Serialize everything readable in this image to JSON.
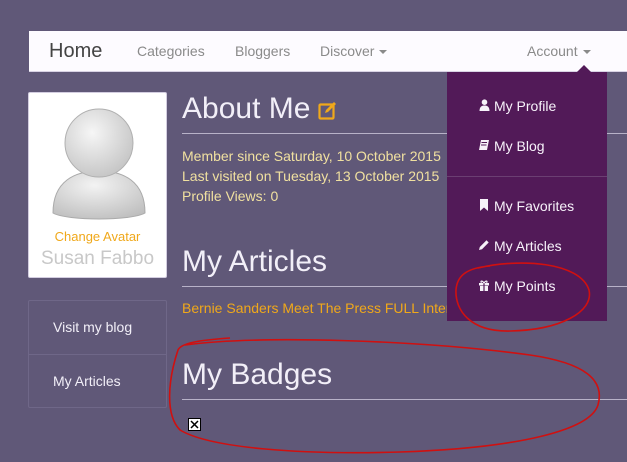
{
  "navbar": {
    "brand": "Home",
    "links": [
      "Categories",
      "Bloggers",
      "Discover"
    ],
    "account": "Account"
  },
  "profile": {
    "change_avatar": "Change Avatar",
    "username": "Susan Fabbo"
  },
  "sidebar": {
    "items": [
      {
        "label": "Visit my blog"
      },
      {
        "label": "My Articles"
      }
    ]
  },
  "about": {
    "title": "About Me",
    "member_since": "Member since Saturday, 10 October 2015",
    "last_visited": "Last visited on Tuesday, 13 October 2015",
    "profile_views": "Profile Views: 0"
  },
  "articles": {
    "title": "My Articles",
    "link": "Bernie Sanders Meet The Press FULL Interv"
  },
  "badges": {
    "title": "My Badges"
  },
  "dropdown": {
    "items": [
      {
        "label": "My Profile",
        "icon": "user-icon"
      },
      {
        "label": "My Blog",
        "icon": "book-icon"
      },
      {
        "label": "My Favorites",
        "icon": "bookmark-icon"
      },
      {
        "label": "My Articles",
        "icon": "pencil-icon"
      },
      {
        "label": "My Points",
        "icon": "gift-icon"
      }
    ]
  },
  "colors": {
    "background": "#605878",
    "dropdown": "#521a58",
    "accent": "#f0a81a",
    "annotation": "#d01010"
  }
}
